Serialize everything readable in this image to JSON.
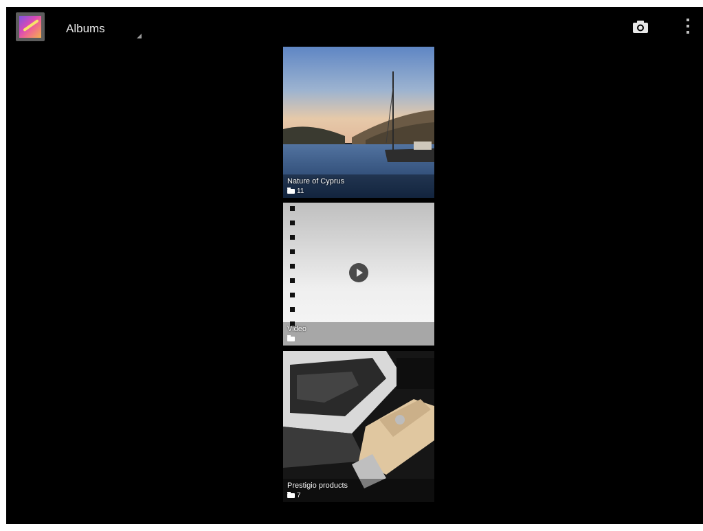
{
  "action_bar": {
    "title": "Albums",
    "app_icon": "gallery-app-icon",
    "camera_icon": "camera-icon",
    "menu_icon": "overflow-menu-icon"
  },
  "albums": [
    {
      "name": "Nature of Cyprus",
      "count": "11",
      "kind": "photo-album"
    },
    {
      "name": "Video",
      "count": "",
      "kind": "video-album"
    },
    {
      "name": "Prestigio products",
      "count": "7",
      "kind": "photo-album"
    }
  ],
  "colors": {
    "background": "#000000",
    "title_text": "#e8e8e8"
  }
}
